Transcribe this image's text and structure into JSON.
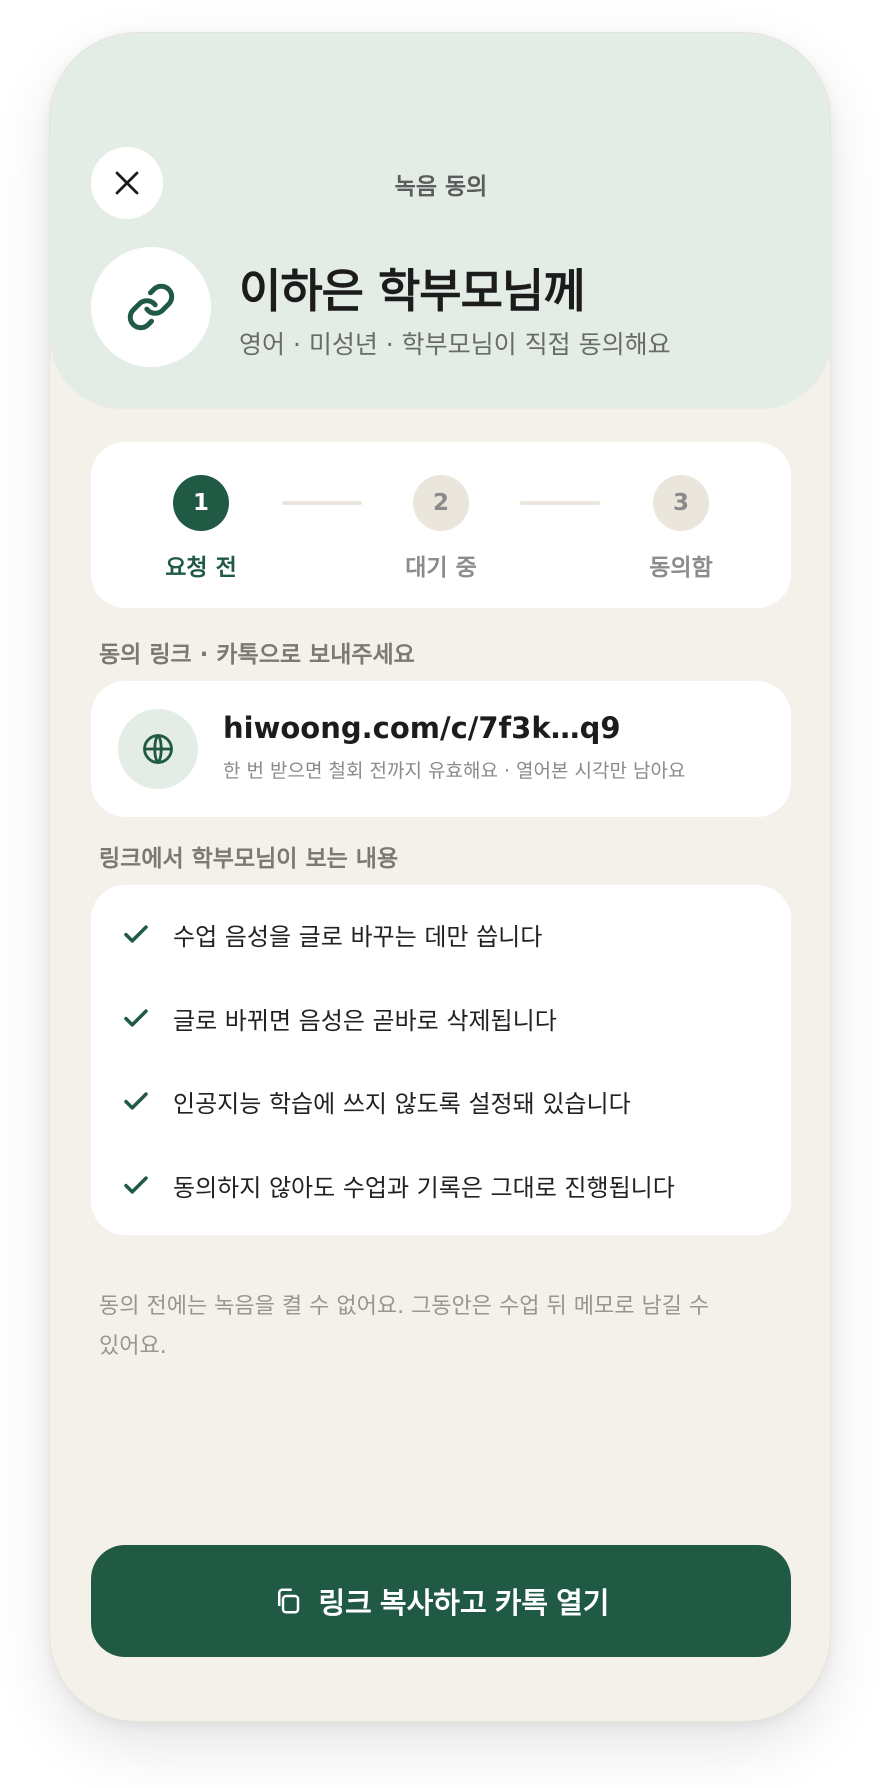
{
  "header": {
    "title": "녹음 동의",
    "recipient_name": "이하은 학부모님께",
    "recipient_sub": "영어 · 미성년 · 학부모님이 직접 동의해요"
  },
  "steps": [
    {
      "number": "1",
      "label": "요청 전",
      "state": "active"
    },
    {
      "number": "2",
      "label": "대기 중",
      "state": "todo"
    },
    {
      "number": "3",
      "label": "동의함",
      "state": "todo"
    }
  ],
  "link_section": {
    "label": "동의 링크 · 카톡으로 보내주세요",
    "url": "hiwoong.com/c/7f3k…q9",
    "note": "한 번 받으면 철회 전까지 유효해요 · 열어본 시각만 남아요"
  },
  "info_section": {
    "label": "링크에서 학부모님이 보는 내용",
    "items": [
      "수업 음성을 글로 바꾸는 데만 씁니다",
      "글로 바뀌면 음성은 곧바로 삭제됩니다",
      "인공지능 학습에 쓰지 않도록 설정돼 있습니다",
      "동의하지 않아도 수업과 기록은 그대로 진행됩니다"
    ]
  },
  "footnote": "동의 전에는 녹음을 켤 수 없어요. 그동안은 수업 뒤 메모로 남길 수 있어요.",
  "cta": {
    "label": "링크 복사하고 카톡 열기"
  },
  "icons": {
    "close": "close-icon",
    "link": "link-icon",
    "globe": "globe-icon",
    "check": "check-icon",
    "copy": "copy-icon"
  },
  "colors": {
    "accent": "#205944",
    "header_bg": "#e3ece5",
    "page_bg": "#f4f1ea",
    "step_inactive": "#ebe6dc"
  }
}
